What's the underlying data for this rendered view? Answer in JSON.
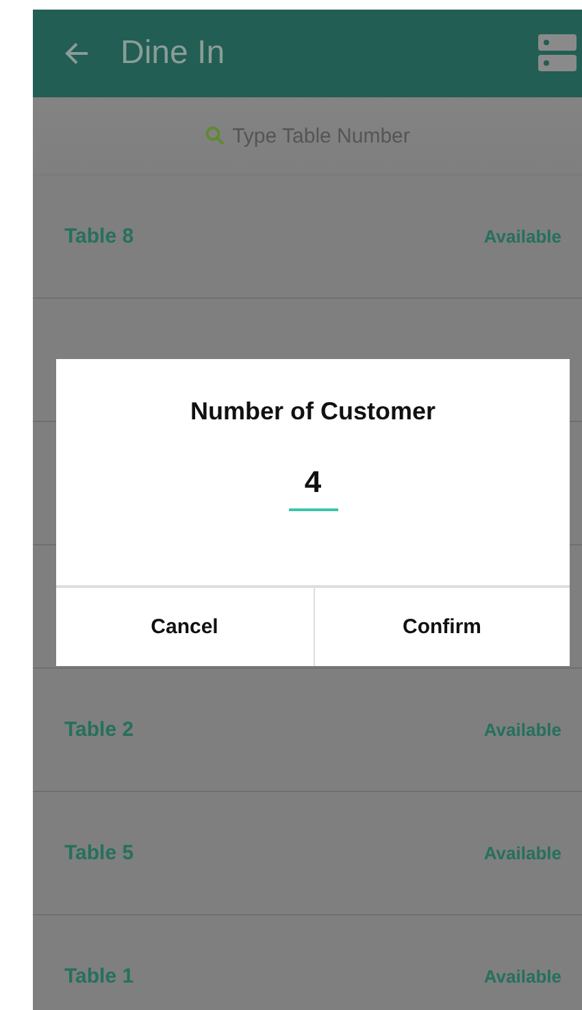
{
  "header": {
    "title": "Dine In"
  },
  "search": {
    "placeholder": "Type Table Number"
  },
  "tables": [
    {
      "name": "Table 8",
      "status": "Available"
    },
    {
      "name": "Table 2",
      "status": "Available"
    },
    {
      "name": "Table 5",
      "status": "Available"
    },
    {
      "name": "Table 1",
      "status": "Available"
    }
  ],
  "dialog": {
    "title": "Number of Customer",
    "value": "4",
    "buttons": [
      "Cancel",
      "Confirm"
    ]
  }
}
